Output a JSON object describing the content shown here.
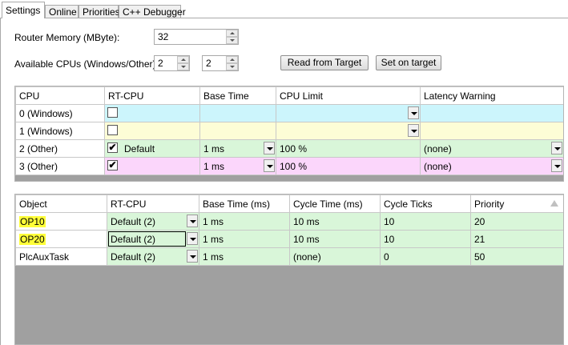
{
  "tabs": [
    "Settings",
    "Online",
    "Priorities",
    "C++ Debugger"
  ],
  "router_memory": {
    "label": "Router Memory (MByte):",
    "value": "32"
  },
  "available_cpus": {
    "label": "Available CPUs (Windows/Other):",
    "windows": "2",
    "other": "2"
  },
  "buttons": {
    "read_from_target": "Read from Target",
    "set_on_target": "Set on target"
  },
  "cpu_table": {
    "headers": [
      "CPU",
      "RT-CPU",
      "Base Time",
      "CPU Limit",
      "Latency Warning"
    ],
    "rows": [
      {
        "cpu": "0 (Windows)",
        "checked": false,
        "rt_cpu": "",
        "base_time": "",
        "cpu_limit": "",
        "latency_warning": "",
        "color": "#ccf5fc"
      },
      {
        "cpu": "1 (Windows)",
        "checked": false,
        "rt_cpu": "",
        "base_time": "",
        "cpu_limit": "",
        "latency_warning": "",
        "color": "#fdfdd6"
      },
      {
        "cpu": "2 (Other)",
        "checked": true,
        "rt_cpu": "Default",
        "base_time": "1 ms",
        "cpu_limit": "100 %",
        "latency_warning": "(none)",
        "color": "#d9f6d9"
      },
      {
        "cpu": "3 (Other)",
        "checked": true,
        "rt_cpu": "",
        "base_time": "1 ms",
        "cpu_limit": "100 %",
        "latency_warning": "(none)",
        "color": "#fbd6fb"
      }
    ]
  },
  "task_table": {
    "headers": [
      "Object",
      "RT-CPU",
      "Base Time (ms)",
      "Cycle Time (ms)",
      "Cycle Ticks",
      "Priority"
    ],
    "rows": [
      {
        "object": "OP10",
        "rt_cpu": "Default (2)",
        "base_time": "1 ms",
        "cycle_time": "10 ms",
        "cycle_ticks": "10",
        "priority": "20",
        "highlight": true
      },
      {
        "object": "OP20",
        "rt_cpu": "Default (2)",
        "base_time": "1 ms",
        "cycle_time": "10 ms",
        "cycle_ticks": "10",
        "priority": "21",
        "highlight": true
      },
      {
        "object": "PlcAuxTask",
        "rt_cpu": "Default (2)",
        "base_time": "1 ms",
        "cycle_time": "(none)",
        "cycle_ticks": "0",
        "priority": "50",
        "highlight": false
      }
    ]
  },
  "colors": {
    "row_green": "#d9f6d9",
    "highlight": "#ffff38",
    "empty_area": "#a0a0a0"
  }
}
